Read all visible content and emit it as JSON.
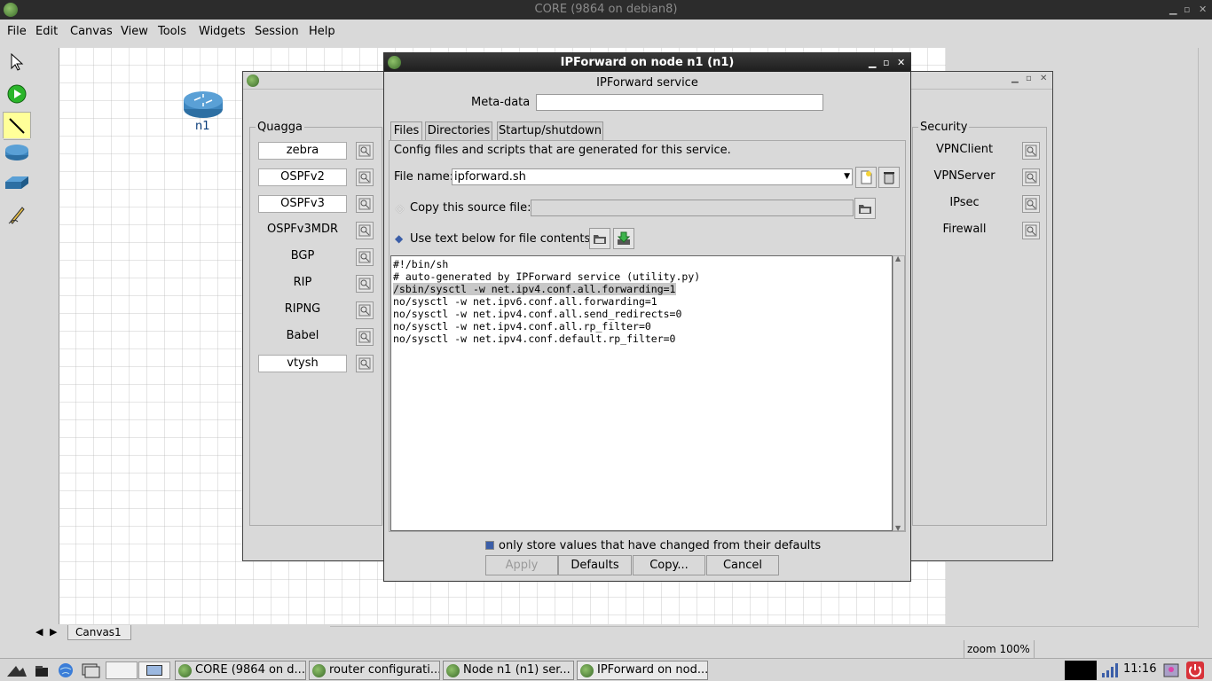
{
  "window": {
    "title": "CORE (9864 on debian8)"
  },
  "menubar": {
    "items": [
      "File",
      "Edit",
      "Canvas",
      "View",
      "Tools",
      "Widgets",
      "Session",
      "Help"
    ]
  },
  "canvas": {
    "node_label": "n1",
    "tab": "Canvas1",
    "zoom": "zoom 100%"
  },
  "services_window": {
    "groups": [
      {
        "title": "Quagga",
        "items": [
          {
            "label": "zebra",
            "enabled": true
          },
          {
            "label": "OSPFv2",
            "enabled": true
          },
          {
            "label": "OSPFv3",
            "enabled": true
          },
          {
            "label": "OSPFv3MDR",
            "enabled": false
          },
          {
            "label": "BGP",
            "enabled": false
          },
          {
            "label": "RIP",
            "enabled": false
          },
          {
            "label": "RIPNG",
            "enabled": false
          },
          {
            "label": "Babel",
            "enabled": false
          },
          {
            "label": "vtysh",
            "enabled": true
          }
        ]
      },
      {
        "title": "Security",
        "items": [
          {
            "label": "VPNClient",
            "enabled": false
          },
          {
            "label": "VPNServer",
            "enabled": false
          },
          {
            "label": "IPsec",
            "enabled": false
          },
          {
            "label": "Firewall",
            "enabled": false
          }
        ]
      }
    ]
  },
  "dialog": {
    "title": "IPForward on node n1 (n1)",
    "service_name": "IPForward service",
    "metadata_label": "Meta-data",
    "metadata_value": "",
    "tabs": [
      "Files",
      "Directories",
      "Startup/shutdown"
    ],
    "description": "Config files and scripts that are generated for this service.",
    "filename_label": "File name:",
    "filename_value": "ipforward.sh",
    "copy_source_label": "Copy this source file:",
    "copy_source_value": "",
    "use_text_label": "Use text below for file contents:",
    "file_lines": [
      "#!/bin/sh",
      "# auto-generated by IPForward service (utility.py)",
      "/sbin/sysctl -w net.ipv4.conf.all.forwarding=1",
      "no/sysctl -w net.ipv6.conf.all.forwarding=1",
      "no/sysctl -w net.ipv4.conf.all.send_redirects=0",
      "no/sysctl -w net.ipv4.conf.all.rp_filter=0",
      "no/sysctl -w net.ipv4.conf.default.rp_filter=0"
    ],
    "only_changed_label": "only store values that have changed from their defaults",
    "buttons": {
      "apply": "Apply",
      "defaults": "Defaults",
      "copy": "Copy...",
      "cancel": "Cancel"
    }
  },
  "taskbar": {
    "tasks": [
      "CORE (9864 on d...",
      "router configurati...",
      "Node n1 (n1) ser...",
      "IPForward on nod..."
    ],
    "clock": "11:16"
  }
}
